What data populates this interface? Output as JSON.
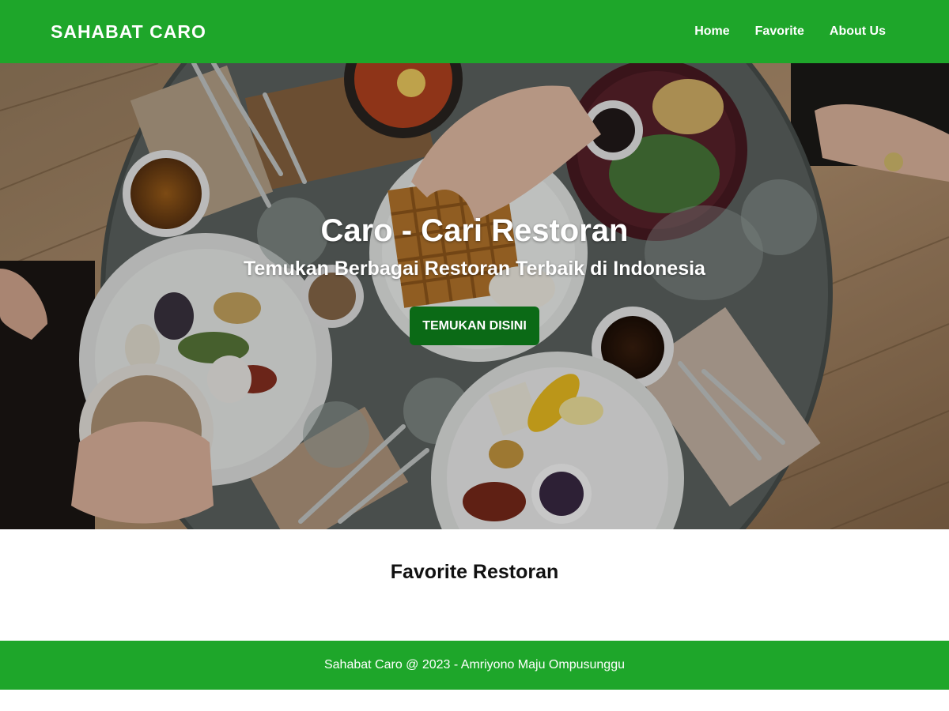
{
  "colors": {
    "brand_green": "#1ea62a",
    "button_green": "#0b6a16",
    "text_light": "#ffffff"
  },
  "header": {
    "brand": "SAHABAT CARO",
    "nav": [
      {
        "label": "Home"
      },
      {
        "label": "Favorite"
      },
      {
        "label": "About Us"
      }
    ]
  },
  "hero": {
    "title": "Caro - Cari Restoran",
    "subtitle": "Temukan Berbagai Restoran Terbaik di Indonesia",
    "button_label": "TEMUKAN DISINI"
  },
  "favorites": {
    "title": "Favorite Restoran"
  },
  "footer": {
    "text": "Sahabat Caro @ 2023 - Amriyono Maju Ompusunggu"
  }
}
